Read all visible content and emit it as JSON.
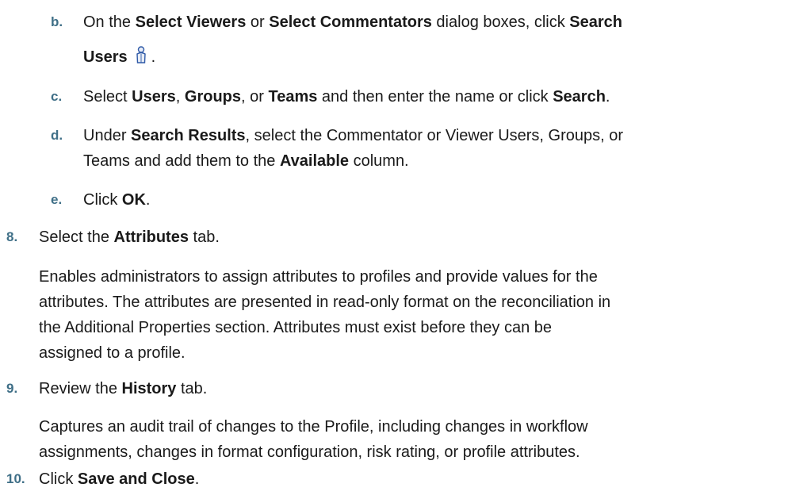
{
  "accent_color": "#3f6f87",
  "steps": {
    "b": {
      "num": "b.",
      "t1": "On the ",
      "b1": "Select Viewers",
      "t2": " or ",
      "b2": "Select Commentators",
      "t3": " dialog boxes, click ",
      "b3": "Search",
      "b4": "Users",
      "t4": "."
    },
    "c": {
      "num": "c.",
      "t1": "Select ",
      "b1": "Users",
      "t2": ", ",
      "b2": "Groups",
      "t3": ", or ",
      "b3": "Teams",
      "t4": " and then enter the name or click ",
      "b4": "Search",
      "t5": "."
    },
    "d": {
      "num": "d.",
      "t1": "Under ",
      "b1": "Search Results",
      "t2": ", select the Commentator or Viewer Users, Groups, or",
      "t3": "Teams and add them to the ",
      "b2": "Available",
      "t4": " column."
    },
    "e": {
      "num": "e.",
      "t1": "Click ",
      "b1": "OK",
      "t2": "."
    },
    "s8": {
      "num": "8.",
      "t1": "Select the ",
      "b1": "Attributes",
      "t2": " tab.",
      "p1": "Enables administrators to assign attributes to profiles and provide values for the",
      "p2": "attributes. The attributes are presented in read-only format on the reconciliation in",
      "p3": "the Additional Properties section. Attributes must exist before they can be",
      "p4": "assigned to a profile."
    },
    "s9": {
      "num": "9.",
      "t1": "Review the ",
      "b1": "History",
      "t2": " tab.",
      "p1": "Captures an audit trail of changes to the Profile, including changes in workflow",
      "p2": "assignments, changes in format configuration, risk rating, or profile attributes."
    },
    "s10": {
      "num": "10.",
      "t1": "Click ",
      "b1": "Save and Close",
      "t2": "."
    }
  }
}
